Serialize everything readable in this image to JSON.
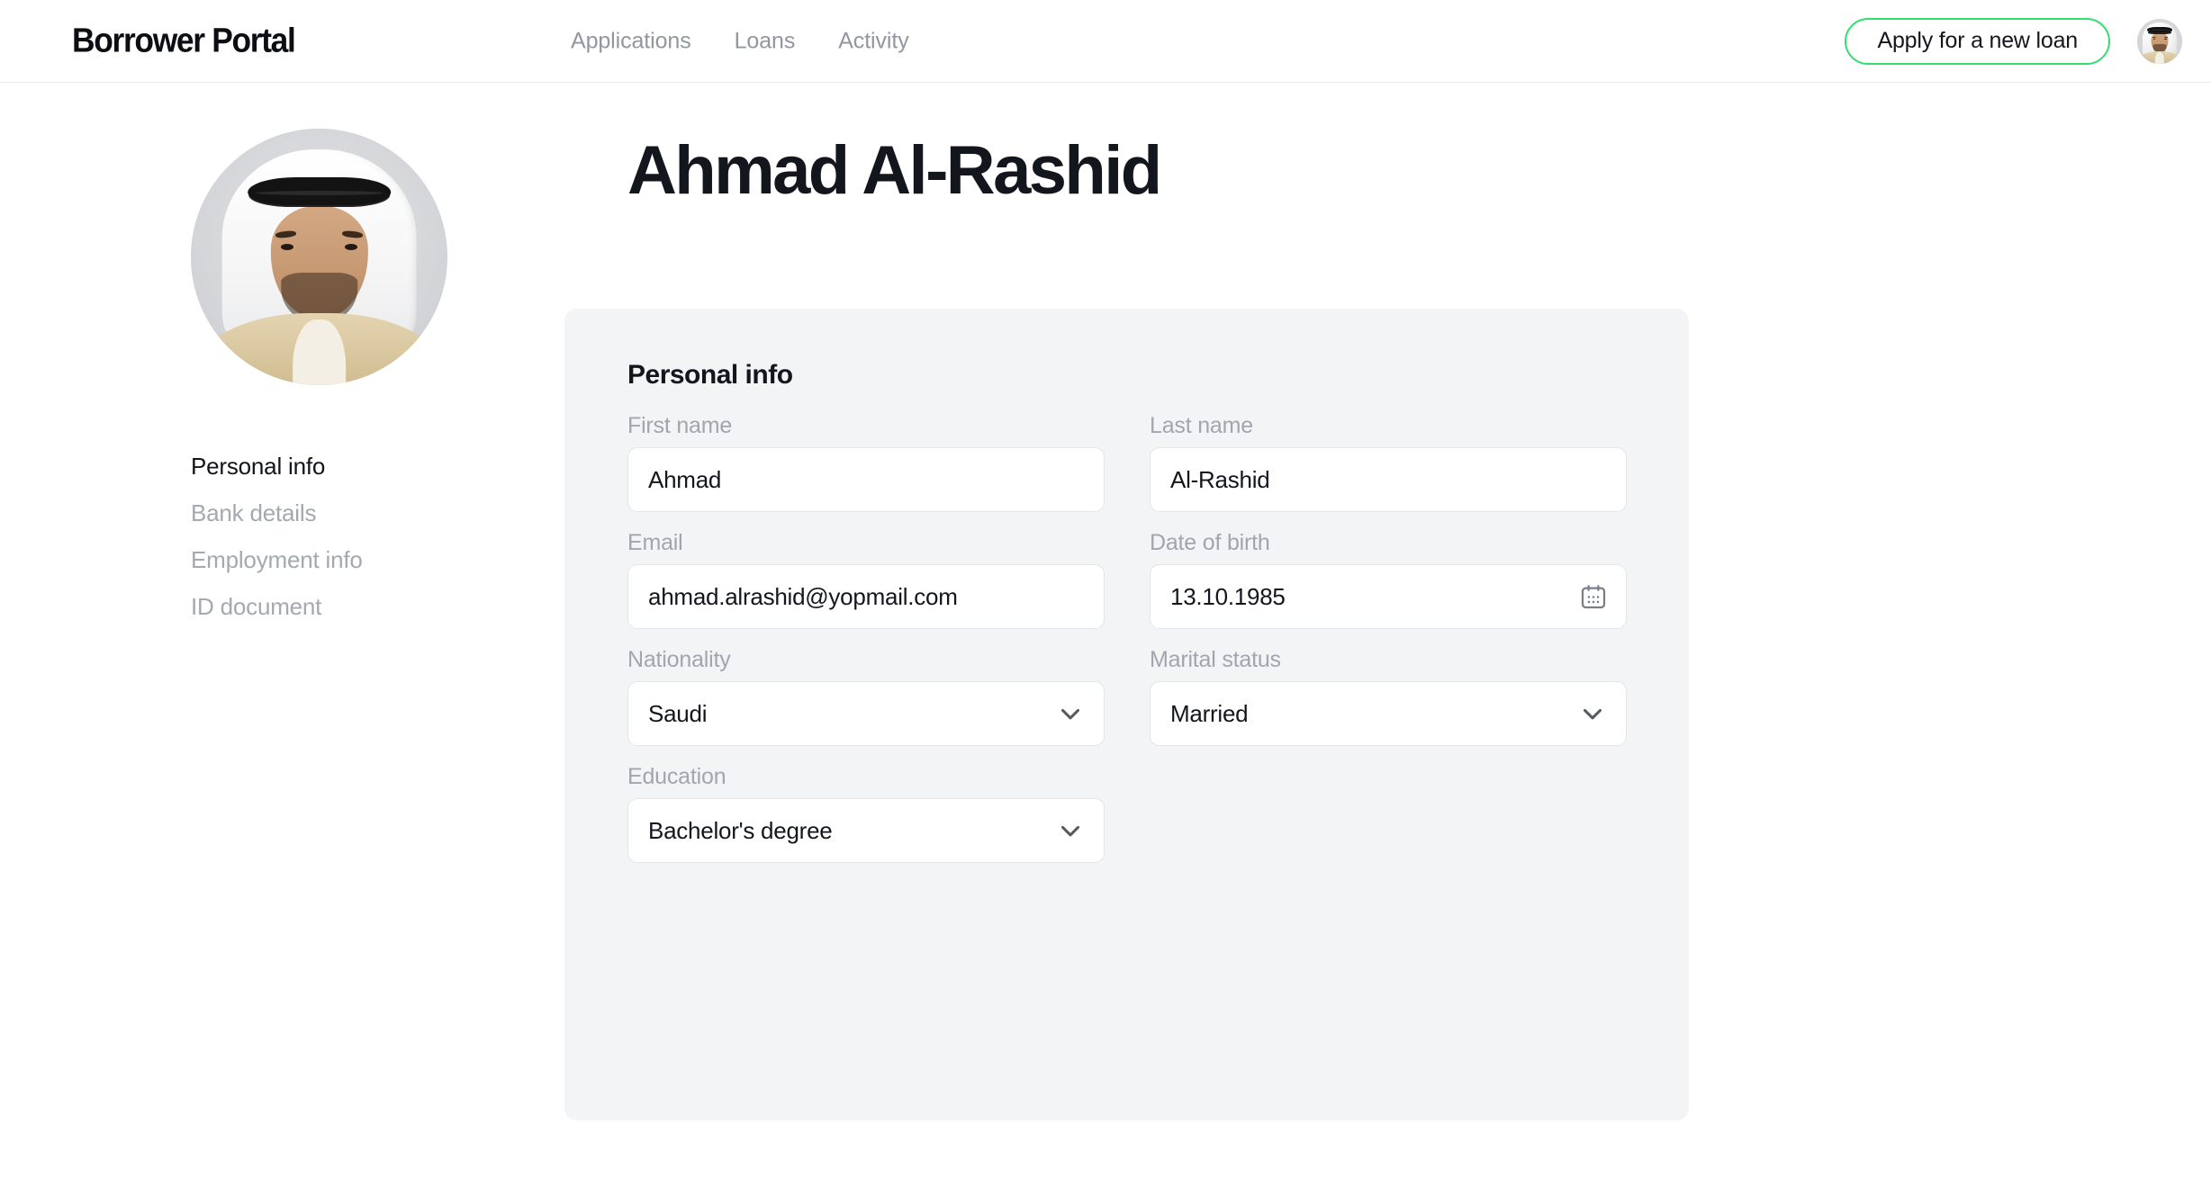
{
  "header": {
    "brand": "Borrower Portal",
    "nav": [
      {
        "label": "Applications"
      },
      {
        "label": "Loans"
      },
      {
        "label": "Activity"
      }
    ],
    "cta_label": "Apply for a new loan",
    "cta_border_color": "#33dd6e",
    "avatar_alt": "user-avatar"
  },
  "sidebar": {
    "avatar_alt": "profile-photo",
    "items": [
      {
        "label": "Personal info",
        "active": true
      },
      {
        "label": "Bank details",
        "active": false
      },
      {
        "label": "Employment info",
        "active": false
      },
      {
        "label": "ID document",
        "active": false
      }
    ]
  },
  "main": {
    "page_title": "Ahmad Al-Rashid",
    "card": {
      "title": "Personal info",
      "background": "#f3f4f6",
      "fields": [
        {
          "key": "first_name",
          "label": "First name",
          "value": "Ahmad",
          "placeholder": "First name",
          "type": "text",
          "icon": ""
        },
        {
          "key": "last_name",
          "label": "Last name",
          "value": "Al-Rashid",
          "placeholder": "Last name",
          "type": "text",
          "icon": ""
        },
        {
          "key": "email",
          "label": "Email",
          "value": "ahmad.alrashid@yopmail.com",
          "placeholder": "Email",
          "type": "text",
          "icon": ""
        },
        {
          "key": "date_of_birth",
          "label": "Date of birth",
          "value": "13.10.1985",
          "placeholder": "DD.MM.YYYY",
          "type": "date",
          "icon": "calendar-icon"
        },
        {
          "key": "nationality",
          "label": "Nationality",
          "value": "Saudi",
          "placeholder": "Select nationality",
          "type": "select",
          "icon": "chevron-down-icon"
        },
        {
          "key": "marital_status",
          "label": "Marital status",
          "value": "Married",
          "placeholder": "Select marital status",
          "type": "select",
          "icon": "chevron-down-icon"
        },
        {
          "key": "education",
          "label": "Education",
          "value": "Bachelor's degree",
          "placeholder": "Select education",
          "type": "select",
          "icon": "chevron-down-icon"
        }
      ]
    }
  },
  "theme": {
    "accent_green": "#33dd6e",
    "text_primary": "#14161d",
    "text_muted": "#a1a5ad",
    "nav_muted": "#9296a0",
    "card_bg": "#f3f4f6",
    "input_bg": "#ffffff",
    "input_border": "#e4e5e8",
    "header_border": "#ececef"
  }
}
